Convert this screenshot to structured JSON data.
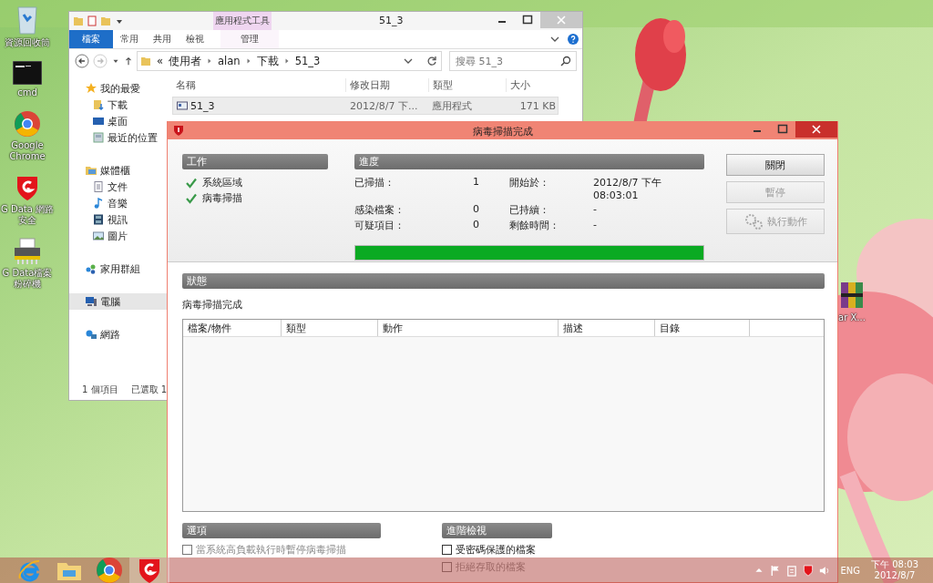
{
  "desktop_icons": [
    {
      "label": "資源回收筒",
      "kind": "bin"
    },
    {
      "label": "cmd",
      "kind": "terminal"
    },
    {
      "label": "Google Chrome",
      "kind": "browser"
    },
    {
      "label": "G Data 網路安全",
      "kind": "shield"
    },
    {
      "label": "G Data檔案粉碎機",
      "kind": "shredder"
    }
  ],
  "desktop_icon_right": {
    "label": "ar X...",
    "kind": "archive"
  },
  "explorer": {
    "title": "51_3",
    "context_group": "應用程式工具",
    "ribbon_tabs": [
      {
        "label": "檔案",
        "selected": true
      },
      {
        "label": "常用",
        "selected": false
      },
      {
        "label": "共用",
        "selected": false
      },
      {
        "label": "檢視",
        "selected": false
      },
      {
        "label": "管理",
        "selected": false
      }
    ],
    "overflow": "«",
    "breadcrumb": [
      "使用者",
      "alan",
      "下載",
      "51_3"
    ],
    "search": {
      "placeholder": "搜尋 51_3"
    },
    "nav": [
      {
        "label": "我的最愛",
        "kind": "star",
        "selected": false,
        "children": [
          {
            "label": "下載",
            "kind": "download",
            "selected": false
          },
          {
            "label": "桌面",
            "kind": "desktop",
            "selected": false
          },
          {
            "label": "最近的位置",
            "kind": "recent",
            "selected": false
          }
        ]
      },
      {
        "label": "媒體櫃",
        "kind": "library",
        "selected": false,
        "children": [
          {
            "label": "文件",
            "kind": "document",
            "selected": false
          },
          {
            "label": "音樂",
            "kind": "music",
            "selected": false
          },
          {
            "label": "視訊",
            "kind": "video",
            "selected": false
          },
          {
            "label": "圖片",
            "kind": "picture",
            "selected": false
          }
        ]
      },
      {
        "label": "家用群組",
        "kind": "homegroup",
        "selected": false
      },
      {
        "label": "電腦",
        "kind": "computer",
        "selected": true
      },
      {
        "label": "網路",
        "kind": "network",
        "selected": false
      }
    ],
    "columns": [
      "名稱",
      "修改日期",
      "類型",
      "大小"
    ],
    "rows": [
      {
        "cells": [
          "51_3",
          "2012/8/7 下...",
          "應用程式",
          "171 KB"
        ],
        "selected": true
      }
    ],
    "status": [
      "1 個項目",
      "已選取 1"
    ]
  },
  "scan_dialog": {
    "title": "病毒掃描完成",
    "work": {
      "header": "工作",
      "tasks": [
        {
          "label": "系統區域",
          "done": true
        },
        {
          "label": "病毒掃描",
          "done": true
        }
      ]
    },
    "progress": {
      "header": "進度",
      "stats_left": [
        {
          "label": "已掃描：",
          "value": "1"
        },
        {
          "label": "感染檔案：",
          "value": "0"
        },
        {
          "label": "可疑項目：",
          "value": "0"
        }
      ],
      "stats_right": [
        {
          "label": "開始於：",
          "value": "2012/8/7 下午 08:03:01"
        },
        {
          "label": "已持續：",
          "value": "-"
        },
        {
          "label": "剩餘時間：",
          "value": "-"
        }
      ],
      "level": 1
    },
    "buttons": [
      {
        "label": "關閉",
        "disabled": false,
        "kind": "plain"
      },
      {
        "label": "暫停",
        "disabled": true,
        "kind": "plain"
      },
      {
        "label": "執行動作",
        "disabled": true,
        "kind": "action"
      }
    ],
    "status": {
      "header": "狀態",
      "text": "病毒掃描完成"
    },
    "columns": [
      "檔案/物件",
      "類型",
      "動作",
      "描述",
      "目錄"
    ],
    "options": {
      "header": "選項",
      "items": [
        {
          "label": "當系統高負載執行時暫停病毒掃描",
          "checked": false,
          "disabled": true
        }
      ]
    },
    "advanced": {
      "header": "進階檢視",
      "items": [
        {
          "label": "受密碼保護的檔案",
          "checked": false,
          "disabled": false
        },
        {
          "label": "拒絕存取的檔案",
          "checked": false,
          "disabled": true
        }
      ]
    }
  },
  "taskbar": {
    "apps": [
      {
        "kind": "ie",
        "selected": false
      },
      {
        "kind": "explorer",
        "selected": false
      },
      {
        "kind": "chrome",
        "selected": false
      },
      {
        "kind": "shield",
        "selected": true
      }
    ],
    "language": "ENG",
    "time": "下午 08:03",
    "date": "2012/8/7"
  }
}
